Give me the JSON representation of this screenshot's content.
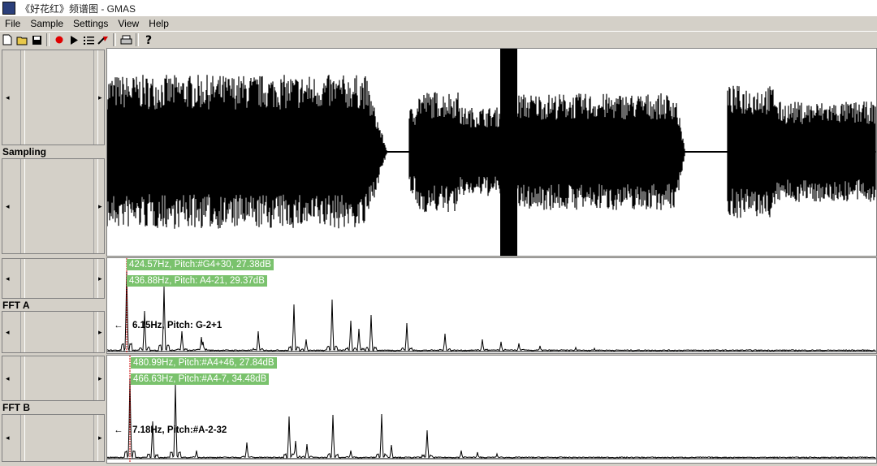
{
  "window": {
    "title": "《好花红》频谱图 - GMAS"
  },
  "menu": [
    "File",
    "Sample",
    "Settings",
    "View",
    "Help"
  ],
  "toolbar": {
    "icons": [
      "new-file-icon",
      "open-folder-icon",
      "save-icon",
      "record-icon",
      "play-icon",
      "list-icon",
      "reverse-icon",
      "print-icon",
      "help-icon"
    ]
  },
  "sections": {
    "sampling": {
      "label": "Sampling"
    },
    "fft_a": {
      "label": "FFT A",
      "peak1": "424.57Hz, Pitch:#G4+30,  27.38dB",
      "peak2": "436.88Hz, Pitch: A4-21,  29.37dB",
      "cursor": "6.15Hz, Pitch: G-2+1",
      "arrow": "←"
    },
    "fft_b": {
      "label": "FFT B",
      "peak1": "480.99Hz, Pitch:#A4+46,  27.84dB",
      "peak2": "466.63Hz, Pitch:#A4-7,  34.48dB",
      "cursor": "7.18Hz, Pitch:#A-2-32",
      "arrow": "←"
    }
  },
  "colors": {
    "label_bg": "#7ac26d",
    "marker": "#cc0000",
    "waveform": "#000000"
  }
}
